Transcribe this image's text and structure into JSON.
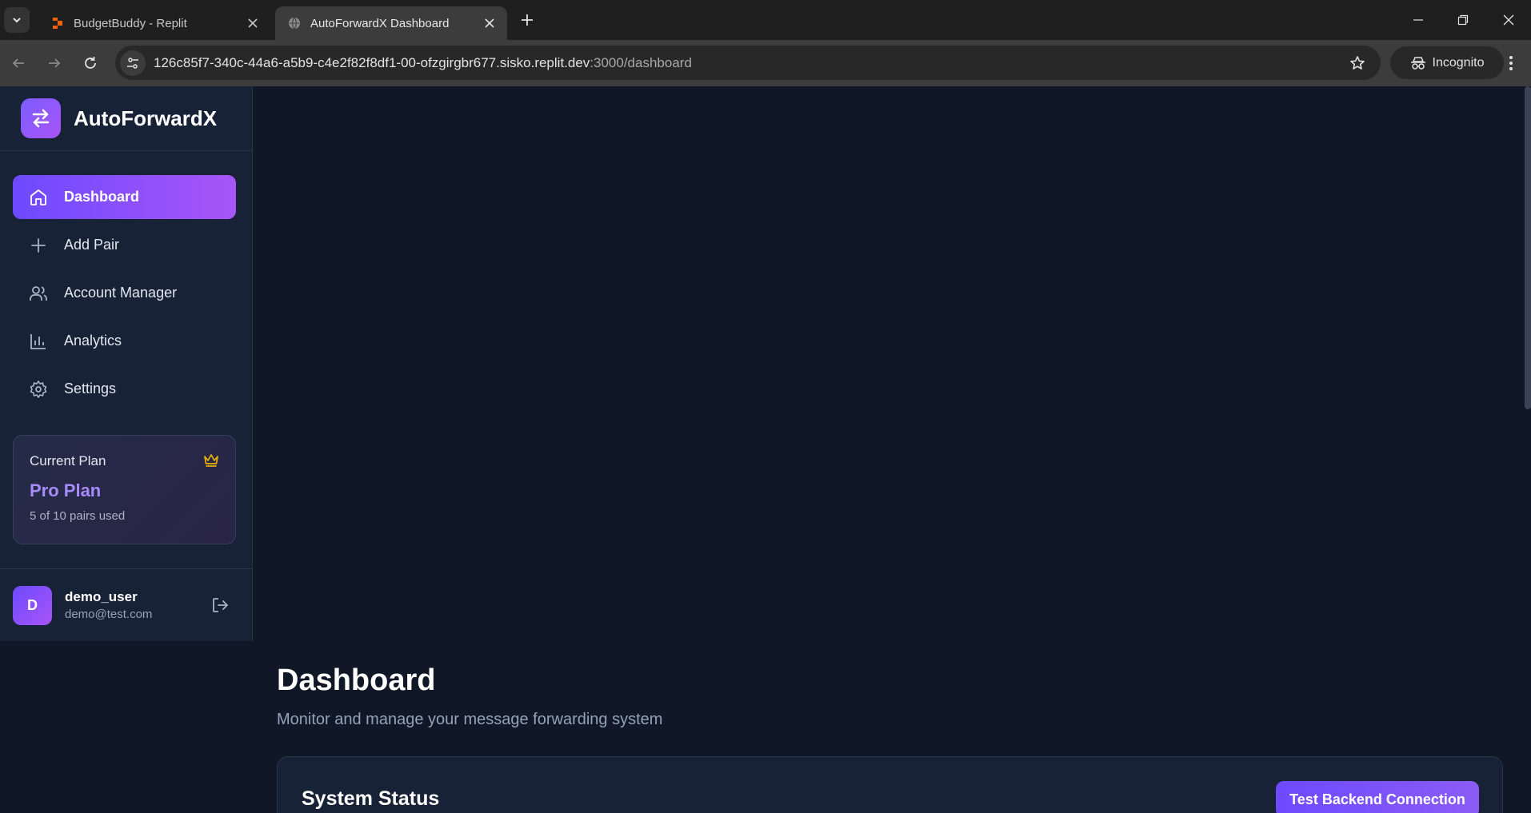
{
  "browser": {
    "tabs": [
      {
        "title": "BudgetBuddy - Replit",
        "active": false,
        "icon": "replit-icon"
      },
      {
        "title": "AutoForwardX Dashboard",
        "active": true,
        "icon": "globe-icon"
      }
    ],
    "url_main": "126c85f7-340c-44a6-a5b9-c4e2f82f8df1-00-ofzgirgbr677.sisko.replit.dev",
    "url_rest": ":3000/dashboard",
    "incognito_label": "Incognito"
  },
  "sidebar": {
    "brand": "AutoForwardX",
    "nav": [
      {
        "label": "Dashboard",
        "icon": "home-icon",
        "active": true
      },
      {
        "label": "Add Pair",
        "icon": "plus-icon",
        "active": false
      },
      {
        "label": "Account Manager",
        "icon": "users-icon",
        "active": false
      },
      {
        "label": "Analytics",
        "icon": "bar-chart-icon",
        "active": false
      },
      {
        "label": "Settings",
        "icon": "gear-icon",
        "active": false
      }
    ],
    "plan": {
      "label": "Current Plan",
      "name": "Pro Plan",
      "usage": "5 of 10 pairs used",
      "icon": "crown-icon"
    },
    "user": {
      "initial": "D",
      "name": "demo_user",
      "email": "demo@test.com"
    }
  },
  "main": {
    "title": "Dashboard",
    "subtitle": "Monitor and manage your message forwarding system",
    "status_card": {
      "title": "System Status",
      "button": "Test Backend Connection"
    }
  },
  "colors": {
    "accent": "#7c5cff",
    "accent_end": "#a855f7",
    "background": "#101828",
    "sidebar": "#182236",
    "plan_name": "#a78bfa",
    "crown": "#eab308"
  }
}
